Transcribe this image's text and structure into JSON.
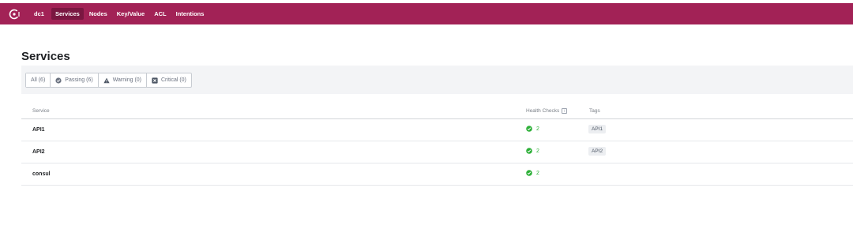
{
  "nav": {
    "datacenter": "dc1",
    "items": [
      {
        "label": "Services",
        "active": true
      },
      {
        "label": "Nodes",
        "active": false
      },
      {
        "label": "Key/Value",
        "active": false
      },
      {
        "label": "ACL",
        "active": false
      },
      {
        "label": "Intentions",
        "active": false
      }
    ],
    "brand_color": "#a22256"
  },
  "page": {
    "title": "Services"
  },
  "filters": [
    {
      "label": "All (6)",
      "icon": "none",
      "selected": true
    },
    {
      "label": "Passing (6)",
      "icon": "check-circle-icon"
    },
    {
      "label": "Warning (0)",
      "icon": "warning-triangle-icon"
    },
    {
      "label": "Critical (0)",
      "icon": "critical-x-icon"
    }
  ],
  "table": {
    "headers": {
      "service": "Service",
      "health": "Health Checks",
      "tags": "Tags"
    },
    "rows": [
      {
        "service": "API1",
        "health_passing": "2",
        "tags": [
          "API1"
        ]
      },
      {
        "service": "API2",
        "health_passing": "2",
        "tags": [
          "API2"
        ]
      },
      {
        "service": "consul",
        "health_passing": "2",
        "tags": []
      }
    ]
  },
  "colors": {
    "passing": "#2eb039",
    "warning": "#6b7280",
    "critical": "#6b7280"
  }
}
